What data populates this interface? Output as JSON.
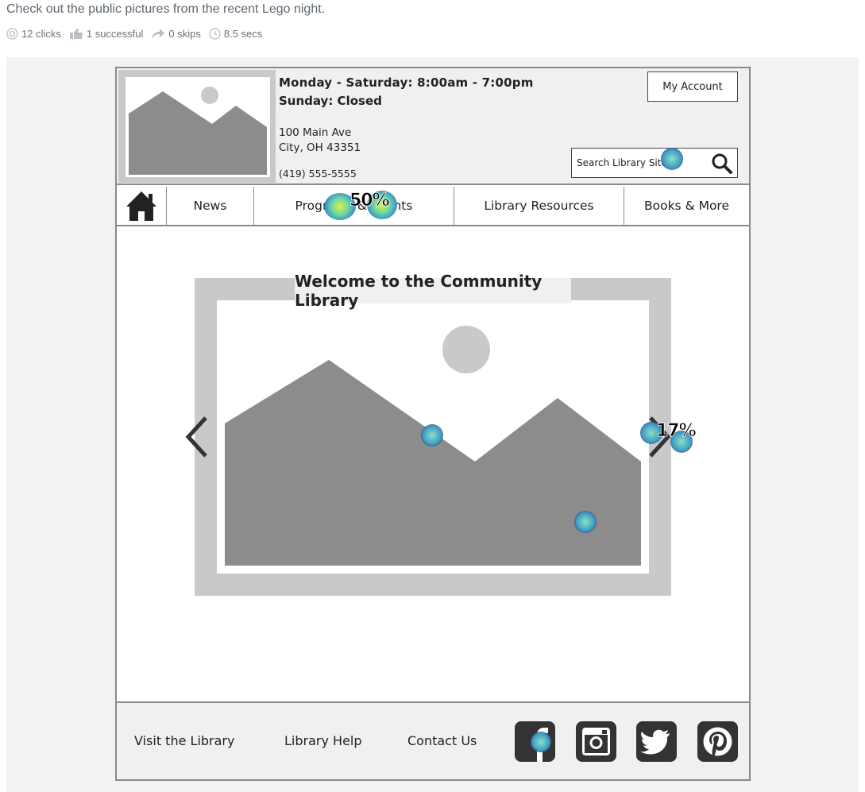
{
  "task": {
    "title": "Check out the public pictures from the recent Lego night.",
    "stats": {
      "clicks": "12 clicks",
      "successful": "1 successful",
      "skips": "0 skips",
      "time": "8.5 secs"
    }
  },
  "site": {
    "header": {
      "hours_weekday": "Monday - Saturday: 8:00am - 7:00pm",
      "hours_sunday": "Sunday: Closed",
      "address_line1": "100 Main Ave",
      "address_line2": "City, OH 43351",
      "phone": "(419) 555-5555",
      "account_label": "My Account",
      "search_placeholder": "Search Library Site"
    },
    "nav": {
      "home_icon": "home-icon",
      "news": "News",
      "programs": "Programs & Events",
      "resources": "Library Resources",
      "books": "Books & More"
    },
    "hero": {
      "title": "Welcome to the Community Library"
    },
    "footer": {
      "visit": "Visit the Library",
      "help": "Library Help",
      "contact": "Contact Us",
      "social": [
        "facebook-icon",
        "instagram-icon",
        "twitter-icon",
        "pinterest-icon"
      ]
    }
  },
  "heatmap": {
    "labels": [
      "50%",
      "17%"
    ]
  },
  "colors": {
    "wire_gray": "#c9c9c9",
    "wire_dark": "#8a8a8a",
    "panel": "#f0f0f0",
    "icon_dark": "#333333"
  }
}
